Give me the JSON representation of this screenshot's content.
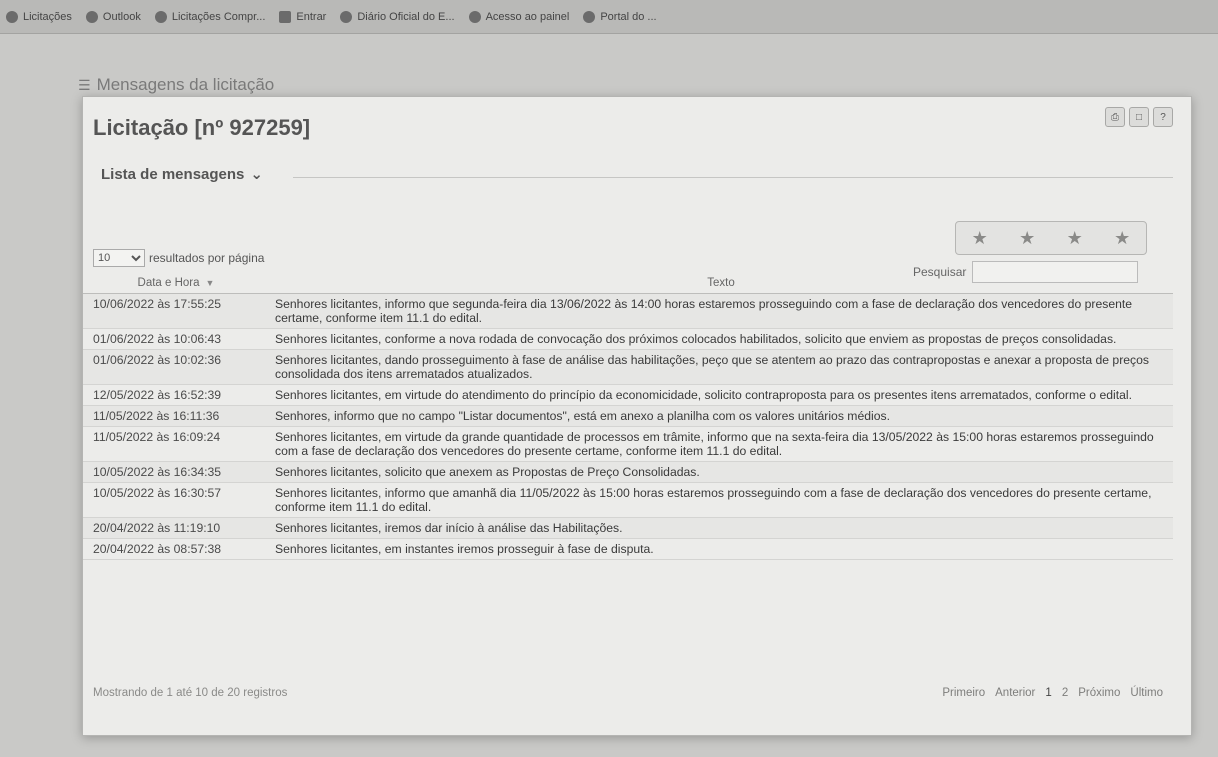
{
  "bookmarks": [
    {
      "label": "Licitações"
    },
    {
      "label": "Outlook"
    },
    {
      "label": "Licitações Compr..."
    },
    {
      "label": "Entrar"
    },
    {
      "label": "Diário Oficial do E..."
    },
    {
      "label": "Acesso ao painel"
    },
    {
      "label": "Portal do ..."
    }
  ],
  "background": {
    "header_title": "Mensagens da licitação"
  },
  "dialog": {
    "title": "Licitação [nº 927259]",
    "subheading": "Lista de mensagens",
    "per_page_value": "10",
    "per_page_label": "resultados por página",
    "search_label": "Pesquisar",
    "search_value": "",
    "columns": [
      "Data e Hora",
      "Texto"
    ],
    "messages": [
      {
        "date": "10/06/2022 às 17:55:25",
        "text": "Senhores licitantes, informo que segunda-feira dia 13/06/2022 às 14:00 horas estaremos prosseguindo com a fase de declaração dos vencedores do presente certame, conforme item 11.1 do edital."
      },
      {
        "date": "01/06/2022 às 10:06:43",
        "text": "Senhores licitantes, conforme a nova rodada de convocação dos próximos colocados habilitados, solicito que enviem as propostas de preços consolidadas."
      },
      {
        "date": "01/06/2022 às 10:02:36",
        "text": "Senhores licitantes, dando prosseguimento à fase de análise das habilitações, peço que se atentem ao prazo das contrapropostas e anexar a proposta de preços consolidada dos itens arrematados atualizados."
      },
      {
        "date": "12/05/2022 às 16:52:39",
        "text": "Senhores licitantes, em virtude do atendimento do princípio da economicidade, solicito contraproposta para os presentes itens arrematados, conforme o edital."
      },
      {
        "date": "11/05/2022 às 16:11:36",
        "text": "Senhores, informo que no campo \"Listar documentos\", está em anexo a planilha com os valores unitários médios."
      },
      {
        "date": "11/05/2022 às 16:09:24",
        "text": "Senhores licitantes, em virtude da grande quantidade de processos em trâmite, informo que na sexta-feira dia 13/05/2022 às 15:00 horas estaremos prosseguindo com a fase de declaração dos vencedores do presente certame, conforme item 11.1 do edital."
      },
      {
        "date": "10/05/2022 às 16:34:35",
        "text": "Senhores licitantes, solicito que anexem as Propostas de Preço Consolidadas."
      },
      {
        "date": "10/05/2022 às 16:30:57",
        "text": "Senhores licitantes, informo que amanhã dia 11/05/2022 às 15:00 horas estaremos prosseguindo com a fase de declaração dos vencedores do presente certame, conforme item 11.1 do edital."
      },
      {
        "date": "20/04/2022 às 11:19:10",
        "text": "Senhores licitantes, iremos dar início à análise das Habilitações."
      },
      {
        "date": "20/04/2022 às 08:57:38",
        "text": "Senhores licitantes, em instantes iremos prosseguir à fase de disputa."
      }
    ],
    "footer_info": "Mostrando de 1 até 10 de 20 registros",
    "pager": {
      "first": "Primeiro",
      "previous": "Anterior",
      "page1": "1",
      "page2": "2",
      "next": "Próximo",
      "last": "Último"
    }
  }
}
